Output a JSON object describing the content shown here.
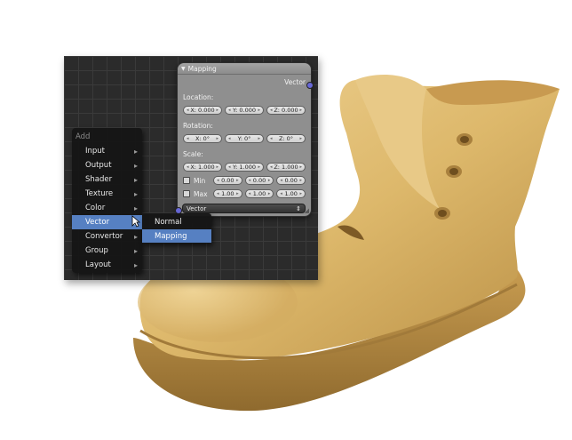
{
  "node": {
    "title": "Mapping",
    "output_socket": "Vector",
    "location_label": "Location:",
    "location": {
      "x": "X: 0.000",
      "y": "Y: 0.000",
      "z": "Z: 0.000"
    },
    "rotation_label": "Rotation:",
    "rotation": {
      "x": "X: 0°",
      "y": "Y: 0°",
      "z": "Z: 0°"
    },
    "scale_label": "Scale:",
    "scale": {
      "x": "X: 1.000",
      "y": "Y: 1.000",
      "z": "Z: 1.000"
    },
    "min_label": "Min",
    "min": {
      "x": "0.00",
      "y": "0.00",
      "z": "0.00"
    },
    "max_label": "Max",
    "max": {
      "x": "1.00",
      "y": "1.00",
      "z": "1.00"
    },
    "vector_select": "Vector"
  },
  "add_menu": {
    "title": "Add",
    "items": [
      {
        "label": "Input"
      },
      {
        "label": "Output"
      },
      {
        "label": "Shader"
      },
      {
        "label": "Texture"
      },
      {
        "label": "Color"
      },
      {
        "label": "Vector"
      },
      {
        "label": "Convertor"
      },
      {
        "label": "Group"
      },
      {
        "label": "Layout"
      }
    ],
    "active_item": "Vector"
  },
  "submenu": {
    "items": [
      {
        "label": "Normal"
      },
      {
        "label": "Mapping"
      }
    ],
    "active_item": "Mapping"
  },
  "render": {
    "subject": "wooden boot",
    "wood_color": "#d9b56a"
  }
}
